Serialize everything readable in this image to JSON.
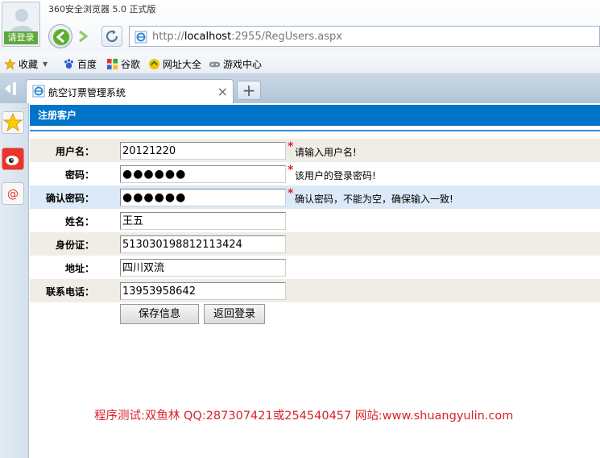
{
  "browser": {
    "title": "360安全浏览器 5.0 正式版",
    "login_label": "请登录",
    "address": {
      "prefix": "http://",
      "host": "localhost",
      "rest": ":2955/RegUsers.aspx"
    },
    "bookmarks": [
      "收藏",
      "百度",
      "谷歌",
      "网址大全",
      "游戏中心"
    ],
    "tab": {
      "label": "航空订票管理系统",
      "close": "×",
      "new": "+"
    }
  },
  "page": {
    "section_title": "注册客户",
    "fields": [
      {
        "label": "用户名：",
        "value": "20121220",
        "required": true,
        "hint": "请输入用户名!"
      },
      {
        "label": "密码：",
        "value": "●●●●●●",
        "required": true,
        "hint": "该用户的登录密码!"
      },
      {
        "label": "确认密码：",
        "value": "●●●●●●",
        "required": true,
        "hint": "确认密码，不能为空，确保输入一致!"
      },
      {
        "label": "姓名：",
        "value": "王五"
      },
      {
        "label": "身份证：",
        "value": "513030198812113424"
      },
      {
        "label": "地址：",
        "value": "四川双流"
      },
      {
        "label": "联系电话：",
        "value": "13953958642"
      }
    ],
    "required_mark": "*",
    "buttons": {
      "save": "保存信息",
      "back": "返回登录"
    },
    "footer": "程序测试:双鱼林 QQ:287307421或254540457 网站:www.shuangyulin.com"
  }
}
